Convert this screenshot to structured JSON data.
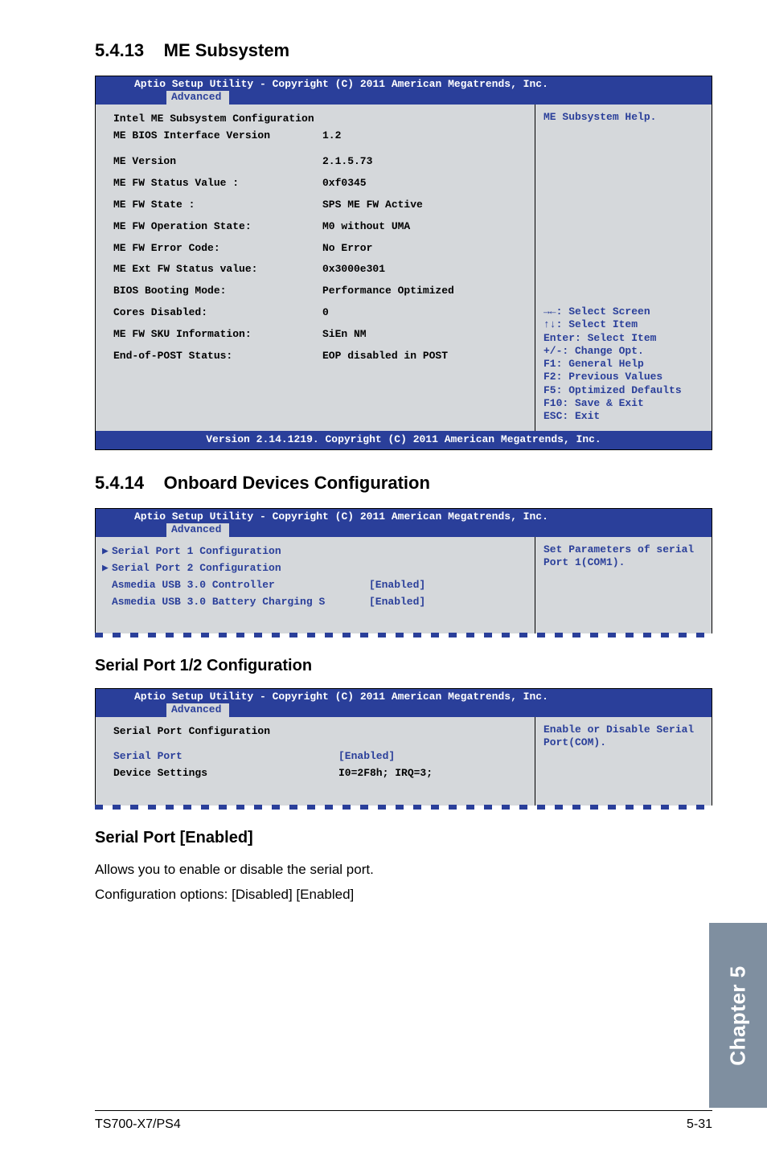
{
  "section1": {
    "number": "5.4.13",
    "title": "ME Subsystem"
  },
  "bios1": {
    "titlebar": "Aptio Setup Utility - Copyright (C) 2011 American Megatrends, Inc.",
    "tab": "Advanced",
    "heading": "Intel ME Subsystem Configuration",
    "rows": [
      {
        "k": "ME BIOS Interface Version",
        "v": "1.2"
      },
      {
        "k": "ME Version",
        "v": "2.1.5.73"
      },
      {
        "k": "ME FW Status Value :",
        "v": "0xf0345"
      },
      {
        "k": "ME FW State        :",
        "v": "   SPS ME FW Active"
      },
      {
        "k": "ME FW Operation State:",
        "v": "    M0 without UMA"
      },
      {
        "k": "ME FW Error Code:",
        "v": "No Error"
      },
      {
        "k": "ME Ext FW Status value:",
        "v": "0x3000e301"
      },
      {
        "k": "BIOS Booting Mode:",
        "v": "Performance Optimized"
      },
      {
        "k": "Cores Disabled:",
        "v": "0"
      },
      {
        "k": "ME FW  SKU Information:",
        "v": "SiEn NM"
      },
      {
        "k": "End-of-POST Status:",
        "v": "EOP disabled in POST"
      }
    ],
    "help_top": "ME Subsystem Help.",
    "help_nav": [
      "→←: Select Screen",
      "↑↓:  Select Item",
      "Enter: Select Item",
      "+/-: Change Opt.",
      "F1: General Help",
      "F2: Previous Values",
      "F5: Optimized Defaults",
      "F10: Save & Exit",
      "ESC: Exit"
    ],
    "footer": "Version 2.14.1219. Copyright (C) 2011 American Megatrends, Inc."
  },
  "section2": {
    "number": "5.4.14",
    "title": "Onboard Devices Configuration"
  },
  "bios2": {
    "titlebar": "Aptio Setup Utility - Copyright (C) 2011 American Megatrends, Inc.",
    "tab": "Advanced",
    "items": [
      {
        "label": "Serial Port 1 Configuration",
        "value": ""
      },
      {
        "label": "Serial Port 2 Configuration",
        "value": ""
      },
      {
        "label": "Asmedia USB 3.0 Controller",
        "value": "[Enabled]"
      },
      {
        "label": "Asmedia USB 3.0 Battery Charging S",
        "value": "[Enabled]"
      }
    ],
    "help": [
      "Set Parameters of serial",
      "Port 1(COM1)."
    ]
  },
  "sub1": "Serial Port 1/2 Configuration",
  "bios3": {
    "titlebar": "Aptio Setup Utility - Copyright (C) 2011 American Megatrends, Inc.",
    "tab": "Advanced",
    "heading": "Serial Port Configuration",
    "rows": [
      {
        "k": "Serial Port",
        "v": "[Enabled]"
      },
      {
        "k": "Device Settings",
        "v": "I0=2F8h; IRQ=3;"
      }
    ],
    "help": [
      "Enable or Disable Serial",
      "Port(COM)."
    ]
  },
  "sub2": "Serial Port [Enabled]",
  "para1": "Allows you to enable or disable the serial port.",
  "para2": "Configuration options: [Disabled] [Enabled]",
  "chapter": "Chapter 5",
  "footer_model": "TS700-X7/PS4",
  "footer_page": "5-31"
}
